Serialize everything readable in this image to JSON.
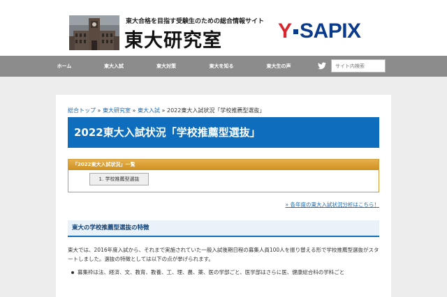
{
  "header": {
    "tagline": "東大合格を目指す受験生のための総合情報サイト",
    "site_title": "東大研究室",
    "sponsor_logo_y": "Y",
    "sponsor_logo_text": "SAPIX"
  },
  "nav": {
    "items": [
      "ホーム",
      "東大入試",
      "東大対策",
      "東大を知る",
      "東大生の声"
    ],
    "twitter_icon": "twitter-icon",
    "search_placeholder": "サイト内検索"
  },
  "breadcrumb": {
    "items": [
      "総合トップ",
      "東大研究室",
      "東大入試"
    ],
    "separator": "»",
    "current": "2022東大入試状況「学校推薦型選抜」"
  },
  "page_title": "2022東大入試状況「学校推薦型選抜」",
  "toc": {
    "header": "「2022東大入試状況」一覧",
    "items": [
      "1. 学校推薦型選抜"
    ]
  },
  "year_link": "» 各年度の東大入試状況分析はこちら！",
  "section": {
    "heading": "東大の学校推薦型選抜の特徴",
    "paragraph": "東大では、2016年度入試から、それまで実施されていた一般入試後期日程の募集人員100人を振り替える形で学校推薦型選抜がスタートしました。選抜の特徴としては以下の点が挙げられます。",
    "bullets": [
      "募集枠は法、経済、文、教育、教養、工、理、農、薬、医の学部ごと、医学部はさらに医、健康総合科の学科ごと"
    ]
  },
  "colors": {
    "brand_blue": "#0e6dbd",
    "nav_gray": "#8c8c8c",
    "toc_orange": "#d39a38",
    "sapix_red": "#d8262e",
    "sapix_navy": "#0a3a8c"
  }
}
